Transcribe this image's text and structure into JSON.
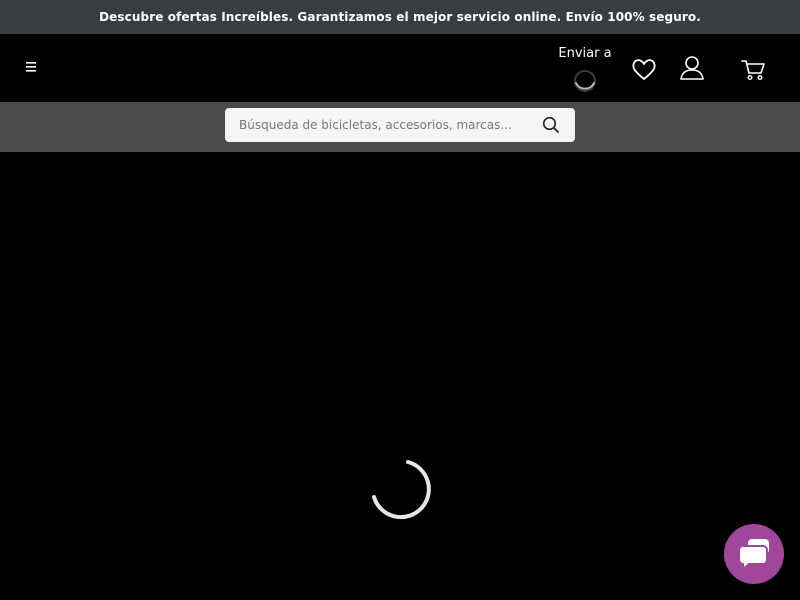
{
  "promo": {
    "text": "Descubre ofertas Increíbles. Garantizamos el mejor servicio online. Envío 100% seguro."
  },
  "header": {
    "menu_icon": "hamburger-menu-icon",
    "ship_to_label": "Enviar a",
    "wishlist_icon": "heart-icon",
    "account_icon": "user-icon",
    "cart_icon": "cart-icon"
  },
  "search": {
    "placeholder": "Búsqueda de bicicletas, accesorios, marcas...",
    "value": "",
    "button_icon": "search-icon"
  },
  "chat": {
    "icon": "chat-icon"
  },
  "colors": {
    "promo_bg": "#3a3d40",
    "header_bg": "#000000",
    "search_bar_bg": "#4a4a4a",
    "chat_button": "#a0479a"
  }
}
